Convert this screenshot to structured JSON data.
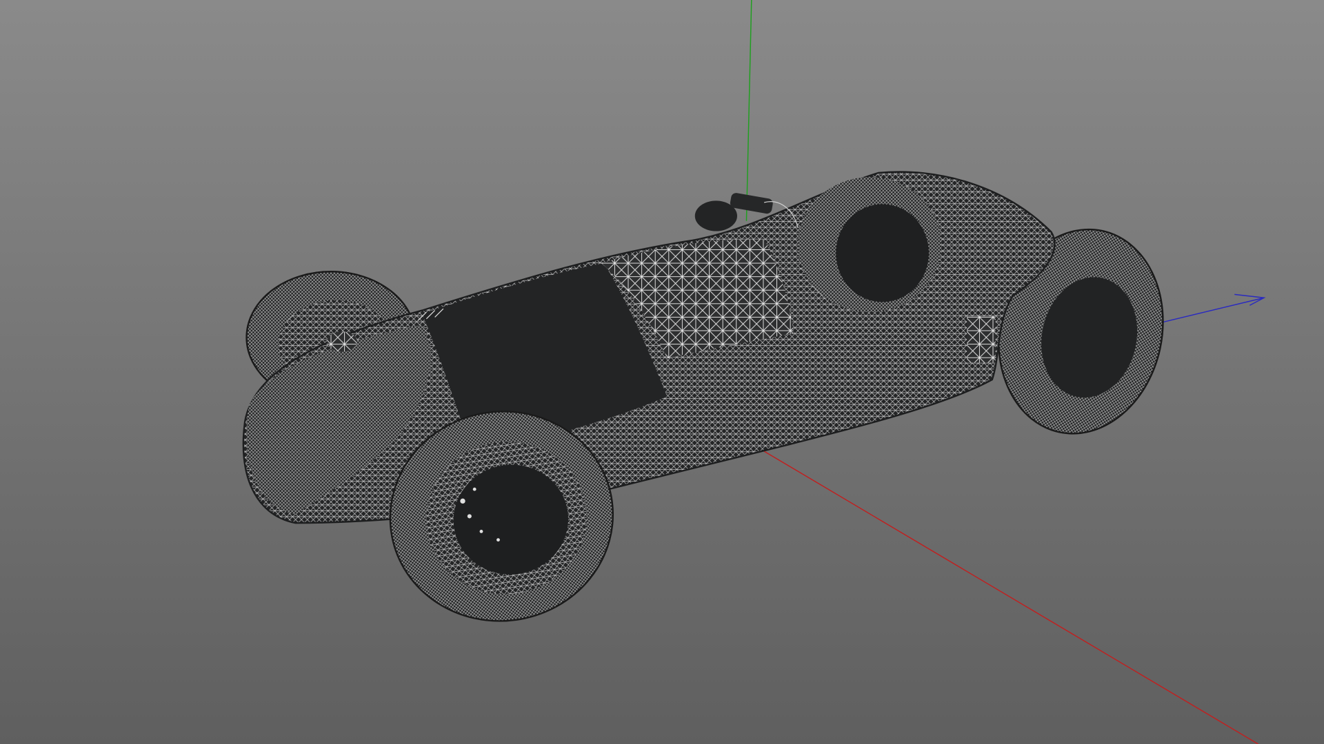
{
  "viewport": {
    "background_top": "#8a8a8a",
    "background_bottom": "#5f5f5f",
    "display_mode": "wireframe"
  },
  "axes": {
    "x": {
      "color": "#c02020"
    },
    "y": {
      "color": "#1fa01f"
    },
    "z": {
      "color": "#2a2ac0"
    }
  },
  "model": {
    "subject": "vintage-race-car",
    "fill_color": "#242526",
    "wire_color": "#ffffff"
  }
}
